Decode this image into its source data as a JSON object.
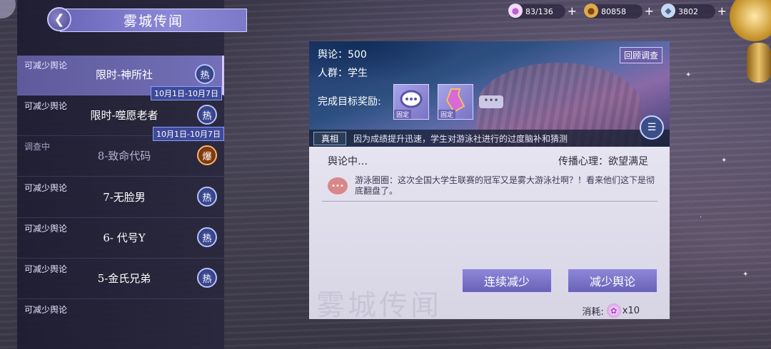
{
  "header": {
    "title": "雾城传闻",
    "back_icon": "arrow-left-icon"
  },
  "resources": [
    {
      "icon": "pink-orb-icon",
      "value": "83/136"
    },
    {
      "icon": "gold-coin-icon",
      "value": "80858"
    },
    {
      "icon": "crystal-icon",
      "value": "3802"
    }
  ],
  "list": [
    {
      "status": "可减少舆论",
      "name": "限时-神所社",
      "badge": "热",
      "date": "10月1日-10月7日"
    },
    {
      "status": "可减少舆论",
      "name": "限时-噬愿老者",
      "badge": "热",
      "date": "10月1日-10月7日"
    },
    {
      "status": "调查中",
      "name": "8-致命代码",
      "badge": "爆"
    },
    {
      "status": "可减少舆论",
      "name": "7-无脸男",
      "badge": "热"
    },
    {
      "status": "可减少舆论",
      "name": "6- 代号Y",
      "badge": "热"
    },
    {
      "status": "可减少舆论",
      "name": "5-金氏兄弟",
      "badge": "热"
    },
    {
      "status": "可减少舆论",
      "name": ""
    }
  ],
  "detail": {
    "opinion_label": "舆论：",
    "opinion_value": "500",
    "crowd_label": "人群：",
    "crowd_value": "学生",
    "reward_label": "完成目标奖励:",
    "reward_tag": "固定",
    "review_btn": "回顾调查",
    "more_btn": "•••",
    "truth_tag": "真相",
    "truth_text": "因为成绩提升迅速，学生对游泳社进行的过度脑补和猜测",
    "opinion_status": "舆论中…",
    "spread_label": "传播心理：欲望满足",
    "comment": "游泳圈圈：这次全国大学生联赛的冠军又是雾大游泳社啊？！看来他们这下是彻底翻盘了。",
    "btn_continuous": "连续减少",
    "btn_reduce": "减少舆论",
    "cost_label": "消耗:",
    "cost_value": "x10",
    "watermark": "雾城传闻"
  }
}
